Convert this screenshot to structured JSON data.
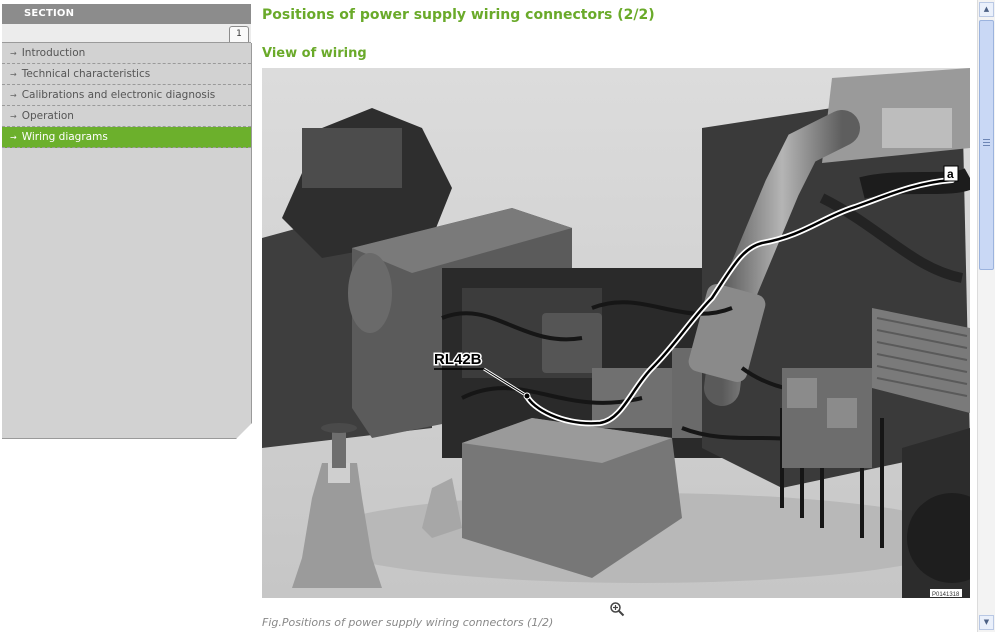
{
  "sidebar": {
    "section_title": "SECTION",
    "tab_label": "1",
    "items": [
      {
        "label": "Introduction",
        "active": false
      },
      {
        "label": "Technical characteristics",
        "active": false
      },
      {
        "label": "Calibrations and electronic diagnosis",
        "active": false
      },
      {
        "label": "Operation",
        "active": false
      },
      {
        "label": "Wiring diagrams",
        "active": true
      }
    ],
    "accent_color": "#6cb02c"
  },
  "main": {
    "title": "Positions of power supply wiring connectors (2/2)",
    "subtitle": "View of wiring",
    "figure": {
      "label_connector": "RL42B",
      "label_marker": "a",
      "figure_code": "P0141318"
    },
    "zoom_icon": "zoom-in-icon",
    "caption": "Fig.Positions of power supply wiring connectors (1/2)"
  },
  "colors": {
    "title_green": "#6aaa2a",
    "nav_background": "#d2d2d2"
  }
}
